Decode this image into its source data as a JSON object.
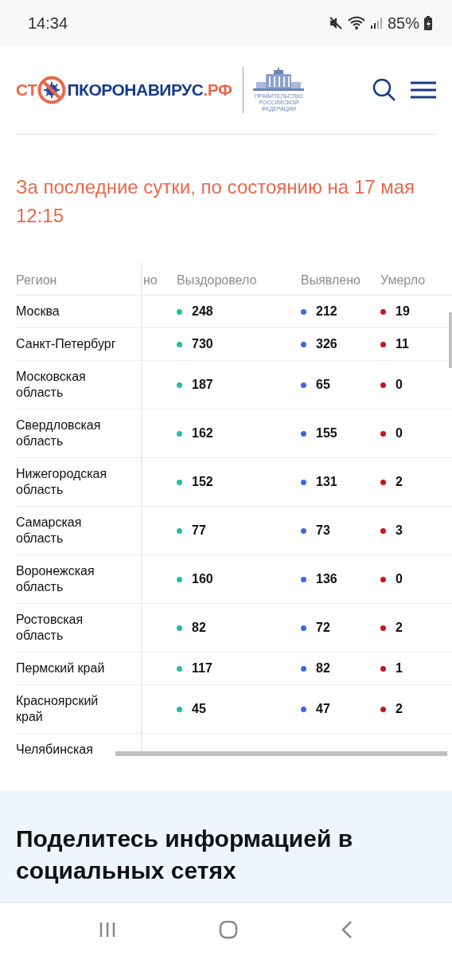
{
  "status_bar": {
    "time": "14:34",
    "battery": "85%"
  },
  "header": {
    "logo": {
      "part_1": "СТ",
      "part_2": "ПКОРОНАВИРУС",
      "part_3": ".РФ"
    },
    "government_logo": [
      "ПРАВИТЕЛЬСТВО",
      "РОССИЙСКОЙ",
      "ФЕДЕРАЦИИ"
    ]
  },
  "title": "За последние сутки, по состоянию на 17 мая 12:15",
  "table": {
    "columns": [
      {
        "label": "Регион"
      },
      {
        "label": "но"
      },
      {
        "label": "Выздоровело",
        "color": "#1fbf9f"
      },
      {
        "label": "Выявлено",
        "color": "#3d66e6"
      },
      {
        "label": "Умерло",
        "color": "#c8161d"
      }
    ],
    "rows": [
      {
        "region": "Москва",
        "values": [
          "248",
          "212",
          "19"
        ]
      },
      {
        "region": "Санкт-Петербург",
        "values": [
          "730",
          "326",
          "11"
        ]
      },
      {
        "region": "Московская область",
        "values": [
          "187",
          "65",
          "0"
        ]
      },
      {
        "region": "Свердловская область",
        "values": [
          "162",
          "155",
          "0"
        ]
      },
      {
        "region": "Нижегородская область",
        "values": [
          "152",
          "131",
          "2"
        ]
      },
      {
        "region": "Самарская область",
        "values": [
          "77",
          "73",
          "3"
        ]
      },
      {
        "region": "Воронежская область",
        "values": [
          "160",
          "136",
          "0"
        ]
      },
      {
        "region": "Ростовская область",
        "values": [
          "82",
          "72",
          "2"
        ]
      },
      {
        "region": "Пермский край",
        "values": [
          "117",
          "82",
          "1"
        ]
      },
      {
        "region": "Красноярский край",
        "values": [
          "45",
          "47",
          "2"
        ]
      },
      {
        "region": "Челябинская"
      }
    ]
  },
  "share": {
    "title": "Поделитесь информацией в социальных сетях"
  }
}
